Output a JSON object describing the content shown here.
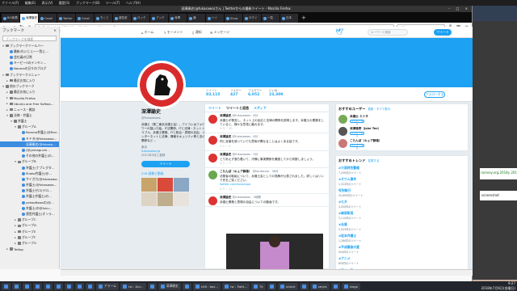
{
  "desktop": {
    "topbar": [
      "ファイル(F)",
      "編集(E)",
      "表示(V)",
      "履歴(S)",
      "ブックマーク(B)",
      "ツール(T)",
      "ヘルプ(H)"
    ],
    "right_term1": "ramsey.org:2018y 2018/",
    "right_term2": "screenshot"
  },
  "browser": {
    "title": "深澤康史(@fukasawa)さん | Twitterからの最新ツイート - Mozilla Firefox",
    "tabs": [
      "Bの新着",
      "深澤康史",
      "Gmail",
      "Twitter",
      "Gmail",
      "ちくと",
      "遊覧室",
      "ロック",
      "ブック",
      "深澤",
      "通",
      "ツイ",
      "Show",
      "ログイ",
      "一覧",
      "日本"
    ],
    "url_identity": "Twitter, Inc. (US)",
    "url": "https://twitter.com/fukasawa?lang=ja",
    "search_placeholder": "検索"
  },
  "sidebar": {
    "header": "ブックマーク",
    "close": "×",
    "search_placeholder": "ブックマークを検索",
    "items": [
      {
        "label": "ブックマークツールバー",
        "type": "folder",
        "depth": 0,
        "open": true
      },
      {
        "label": "最新/れいじぇ〜一覧に…",
        "type": "bookmark",
        "depth": 1
      },
      {
        "label": "会社員の日常",
        "type": "bookmark",
        "depth": 1
      },
      {
        "label": "キーピー3のテンキン…",
        "type": "bookmark",
        "depth": 1
      },
      {
        "label": "Noronaの日々のブログ",
        "type": "bookmark",
        "depth": 1
      },
      {
        "label": "ブックマークメニュー",
        "type": "folder",
        "depth": 0,
        "open": true
      },
      {
        "label": "最近お気に入り",
        "type": "folder",
        "depth": 1
      },
      {
        "label": "他のブックマーク",
        "type": "folder",
        "depth": 0,
        "open": true
      },
      {
        "label": "最近お気に入り",
        "type": "folder",
        "depth": 1
      },
      {
        "label": "Mozilla Firefox",
        "type": "folder",
        "depth": 1
      },
      {
        "label": "Ubuntu and Free Softwa…",
        "type": "folder",
        "depth": 1
      },
      {
        "label": "ニュース・雑誌",
        "type": "folder",
        "depth": 1
      },
      {
        "label": "法律・弁護士",
        "type": "folder",
        "depth": 1,
        "open": true
      },
      {
        "label": "弁護士",
        "type": "folder",
        "depth": 2,
        "open": true
      },
      {
        "label": "グループA",
        "type": "folder",
        "depth": 3,
        "open": true
      },
      {
        "label": "fkorona弁護士(@fkor…",
        "type": "bookmark",
        "depth": 4
      },
      {
        "label": "ミドタ(@fukasawa…",
        "type": "bookmark",
        "depth": 4
      },
      {
        "label": "深澤康史(@fukasa…",
        "type": "bookmark",
        "depth": 4,
        "selected": true
      },
      {
        "label": "(@yamaguchi…",
        "type": "bookmark",
        "depth": 4
      },
      {
        "label": "その他の弁護士(の…",
        "type": "bookmark",
        "depth": 4
      },
      {
        "label": "グループB",
        "type": "folder",
        "depth": 3,
        "open": true
      },
      {
        "label": "弁護士(ナブレグタ…",
        "type": "bookmark",
        "depth": 4
      },
      {
        "label": "Shoko弁護士(@…",
        "type": "bookmark",
        "depth": 4
      },
      {
        "label": "サイガカ(@fukasawa…",
        "type": "bookmark",
        "depth": 4
      },
      {
        "label": "弁護士(@fukasawa…",
        "type": "bookmark",
        "depth": 4
      },
      {
        "label": "弁護士ゼロ(テロ…",
        "type": "bookmark",
        "depth": 4
      },
      {
        "label": "弁護士弁護士(の…",
        "type": "bookmark",
        "depth": 4
      },
      {
        "label": "yahooNewsの(@…",
        "type": "bookmark",
        "depth": 4
      },
      {
        "label": "弁護士(の@fuku…",
        "type": "bookmark",
        "depth": 4
      },
      {
        "label": "運営弁護士(オンラ…",
        "type": "bookmark",
        "depth": 4
      },
      {
        "label": "グループC",
        "type": "folder",
        "depth": 3
      },
      {
        "label": "グループD",
        "type": "folder",
        "depth": 3
      },
      {
        "label": "グループE",
        "type": "folder",
        "depth": 3
      },
      {
        "label": "グループF",
        "type": "folder",
        "depth": 3
      },
      {
        "label": "グループG",
        "type": "folder",
        "depth": 3
      },
      {
        "label": "Twilog",
        "type": "folder",
        "depth": 1
      }
    ]
  },
  "twitter": {
    "nav": [
      "ホーム",
      "モーメント",
      "通知",
      "メッセージ"
    ],
    "search_placeholder": "キーワード検索",
    "tweet_button": "ツイート",
    "stats": [
      {
        "label": "ツイート",
        "value": "83,115"
      },
      {
        "label": "フォロー",
        "value": "427"
      },
      {
        "label": "フォロワー",
        "value": "6,052"
      },
      {
        "label": "いいね",
        "value": "23,309"
      }
    ],
    "follow_button": "フォローする",
    "profile": {
      "name": "深澤諭史",
      "handle": "@fukazawas",
      "bio": "弁護士（第二東京弁護士会）。アイコンはフォロワーの描いた絵。IT法関係、ITと法律・ネットトラブル、弁護士業務、ITと政治・表現の自由、インターネットと法律、情報セキュリティ等と法の関係など…",
      "location": "東京",
      "link": "fukazawas.jp",
      "joined": "2011年3月に登録",
      "tweet_btn": "ツイート",
      "media_label": "226 画像と動画"
    },
    "timeline_tabs": [
      "ツイート",
      "ツイートと返信",
      "メディア"
    ],
    "tweets": [
      {
        "name": "深澤諭史",
        "handle": "@fukazawas · 6分",
        "text": "弁護士が発言し、ネット上の反応と法律の関係を説明します。弁護士の業務をしていると、様々な意見に触れます。",
        "actions": "↺ 3   ♡ 10",
        "color": "#d33"
      },
      {
        "name": "深澤諭史",
        "handle": "@fukazawas · 8分",
        "text": "同じ言葉を使っていても意味が異なることはよくある話です。",
        "actions": "↺ 1   ♡ 4",
        "color": "#d33"
      },
      {
        "name": "深澤諭史",
        "handle": "@fukazawas · 9分",
        "text": "とりあえず落ち着いて、冷静に事実関係を確認してから判断しましょう。",
        "actions": "↺ 2   ♡ 7",
        "color": "#d33"
      },
      {
        "name": "こたんぽ（キュア静雄）",
        "handle": "@koutanpo · 38分",
        "text": "法務省の取組について、弁護士会としての見解が公表されました。詳しくはリンク先をご覧ください。",
        "link": "twitter.com/koutanpo",
        "actions": "↺ 5   ♡ 12",
        "color": "#6aa84f"
      },
      {
        "name": "深澤諭史",
        "handle": "@fukazawas · 1時間",
        "text": "弁護士業務と表現の自由についての動画です。",
        "actions": "",
        "color": "#d33"
      }
    ],
    "who_to_follow": {
      "title": "おすすめユーザー",
      "refresh": "更新・すべて表示",
      "users": [
        {
          "name": "弁護士 ミドタ",
          "color": "#7a5"
        },
        {
          "name": "深澤雄壱（Jake Ten）",
          "color": "#555"
        },
        {
          "name": "こたんぽ（キュア静雄）",
          "color": "#c77"
        }
      ],
      "follow_label": "フォローする"
    },
    "trends": {
      "title": "おすすめトレンド",
      "change": "変更する",
      "items": [
        {
          "name": "#大雨特別警報",
          "count": "7,430件のツイート"
        },
        {
          "name": "#オウム事件",
          "count": "1,322件のツイート"
        },
        {
          "name": "死刑執行",
          "count": "25,600件のツイート"
        },
        {
          "name": "#七夕",
          "count": "4,050件のツイート"
        },
        {
          "name": "#麻原彰晃",
          "count": "3,112件のツイート"
        },
        {
          "name": "#台風",
          "count": "2,003件のツイート"
        },
        {
          "name": "#坂本弁護士",
          "count": "1,280件のツイート"
        },
        {
          "name": "#平成最後の夏",
          "count": "920件のツイート"
        },
        {
          "name": "#アニメ",
          "count": "850件のツイート"
        },
        {
          "name": "#ニュース",
          "count": "610件のツイート"
        }
      ]
    }
  },
  "taskbar": {
    "items": [
      "",
      "",
      "",
      "",
      "",
      "",
      "",
      "",
      "",
      "アラーム",
      "tw - Dol…",
      "",
      "深澤康史",
      "",
      "e46 : bas…",
      "tw - Twitt…",
      "Tk",
      "",
      "xclock",
      "",
      "xeyes",
      "",
      "xlogo"
    ],
    "time": "9:27",
    "date": "2018年7月6日(金曜日)"
  },
  "colors": {
    "twitter_blue": "#1da1f2",
    "selection": "#3b8ce0"
  }
}
